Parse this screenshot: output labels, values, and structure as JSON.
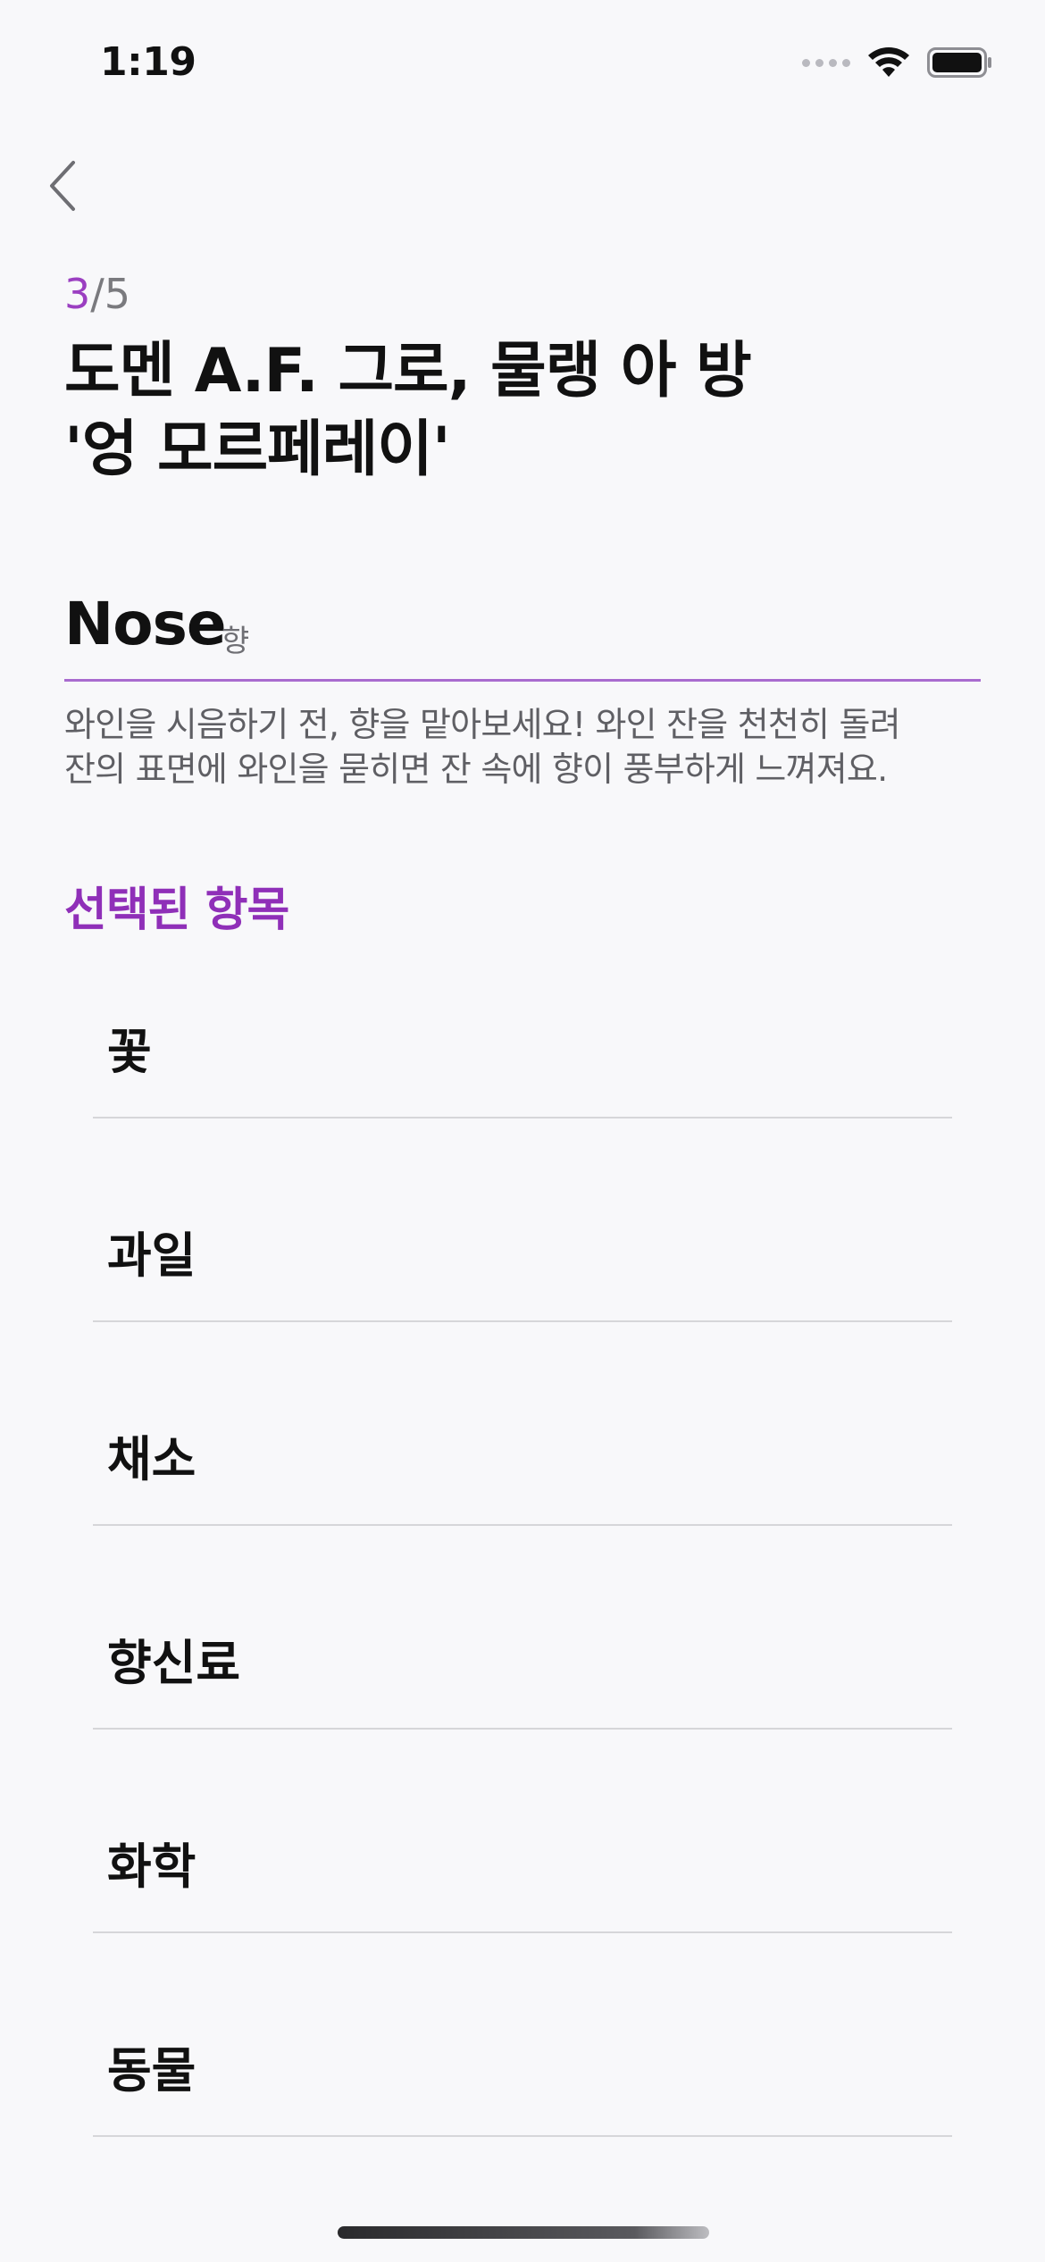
{
  "status_bar": {
    "time": "1:19",
    "icons": [
      "cellular-signal-icon",
      "wifi-icon",
      "battery-icon"
    ]
  },
  "nav": {
    "back_icon": "chevron-left-icon"
  },
  "progress": {
    "current": "3",
    "total": "/5"
  },
  "wine": {
    "title_line1": "도멘 A.F. 그로, 물랭 아 방",
    "title_line2": "'엉 모르페레이'"
  },
  "section": {
    "title": "Nose",
    "subtitle": "향",
    "description_line1": "와인을 시음하기 전, 향을 맡아보세요! 와인 잔을 천천히 돌려",
    "description_line2": "잔의 표면에 와인을 묻히면 잔 속에 향이 풍부하게 느껴져요."
  },
  "selected": {
    "title": "선택된 항목",
    "items": [
      {
        "label": "꽃"
      },
      {
        "label": "과일"
      },
      {
        "label": "채소"
      },
      {
        "label": "향신료"
      },
      {
        "label": "화학"
      },
      {
        "label": "동물"
      }
    ]
  },
  "colors": {
    "accent": "#9b3fc1",
    "background": "#f8f8fa",
    "divider": "#d6d6d9"
  }
}
